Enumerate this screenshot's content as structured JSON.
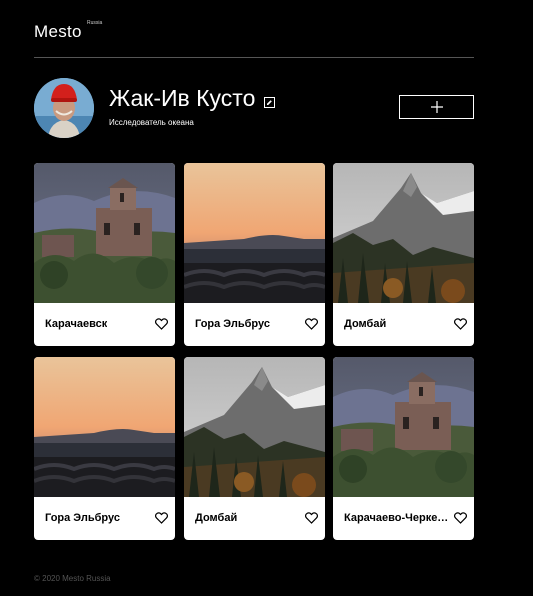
{
  "header": {
    "logo": "Mesto",
    "logo_sup": "Russia"
  },
  "profile": {
    "name": "Жак-Ив Кусто",
    "about": "Исследователь океана",
    "edit_icon": "pencil-icon",
    "add_icon": "plus-icon"
  },
  "cards": [
    {
      "title": "Карачаевск",
      "scene": "church"
    },
    {
      "title": "Гора Эльбрус",
      "scene": "sunset"
    },
    {
      "title": "Домбай",
      "scene": "mountain"
    },
    {
      "title": "Гора Эльбрус",
      "scene": "sunset"
    },
    {
      "title": "Домбай",
      "scene": "mountain"
    },
    {
      "title": "Карачаево-Черкесия",
      "scene": "church"
    }
  ],
  "footer": {
    "copyright": "© 2020 Mesto Russia"
  }
}
